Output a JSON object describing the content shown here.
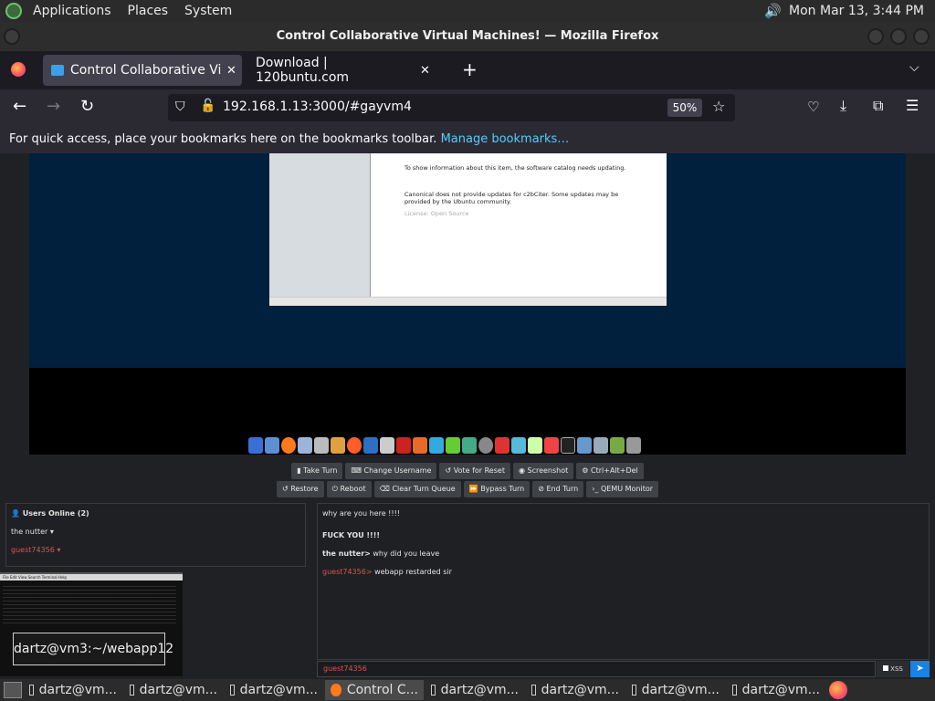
{
  "panel": {
    "applications": "Applications",
    "places": "Places",
    "system": "System",
    "clock": "Mon Mar 13,  3:44 PM"
  },
  "window": {
    "title": "Control Collaborative Virtual Machines! — Mozilla Firefox"
  },
  "tabs": [
    {
      "label": "Control Collaborative Virtua"
    },
    {
      "label": "Download | 120buntu.com"
    }
  ],
  "urlbar": {
    "url": "192.168.1.13:3000/#gayvm4",
    "zoom": "50%"
  },
  "bookmarks": {
    "message": "For quick access, place your bookmarks here on the bookmarks toolbar.",
    "link": "Manage bookmarks…"
  },
  "vm": {
    "info1": "To show information about this item, the software catalog needs updating.",
    "info2": "Canonical does not provide updates for c2bCiter. Some updates may be provided by the Ubuntu community.",
    "info3": "License: Open Source"
  },
  "controls": {
    "row1": [
      "Take Turn",
      "Change Username",
      "Vote for Reset",
      "Screenshot",
      "Ctrl+Alt+Del"
    ],
    "row2": [
      "Restore",
      "Reboot",
      "Clear Turn Queue",
      "Bypass Turn",
      "End Turn",
      "QEMU Monitor"
    ]
  },
  "users": {
    "heading": "Users Online (2)",
    "list": [
      "the nutter",
      "guest74356"
    ]
  },
  "chat": {
    "messages": [
      {
        "user": "",
        "text": "why are you here !!!!"
      },
      {
        "user": "",
        "text": "FUCK YOU !!!!"
      },
      {
        "user": "the nutter>",
        "text": "why did you leave"
      },
      {
        "user": "guest74356>",
        "text": "webapp restarded sir"
      }
    ],
    "input_user": "guest74356",
    "xss_label": "XSS"
  },
  "thumbnail": {
    "menu": "File  Edit  View  Search  Terminal  Help",
    "label": "dartz@vm3:~/webapp12"
  },
  "taskbar": {
    "items": [
      "dartz@vm...",
      "dartz@vm...",
      "dartz@vm...",
      "Control C...",
      "dartz@vm...",
      "dartz@vm...",
      "dartz@vm...",
      "dartz@vm..."
    ]
  }
}
